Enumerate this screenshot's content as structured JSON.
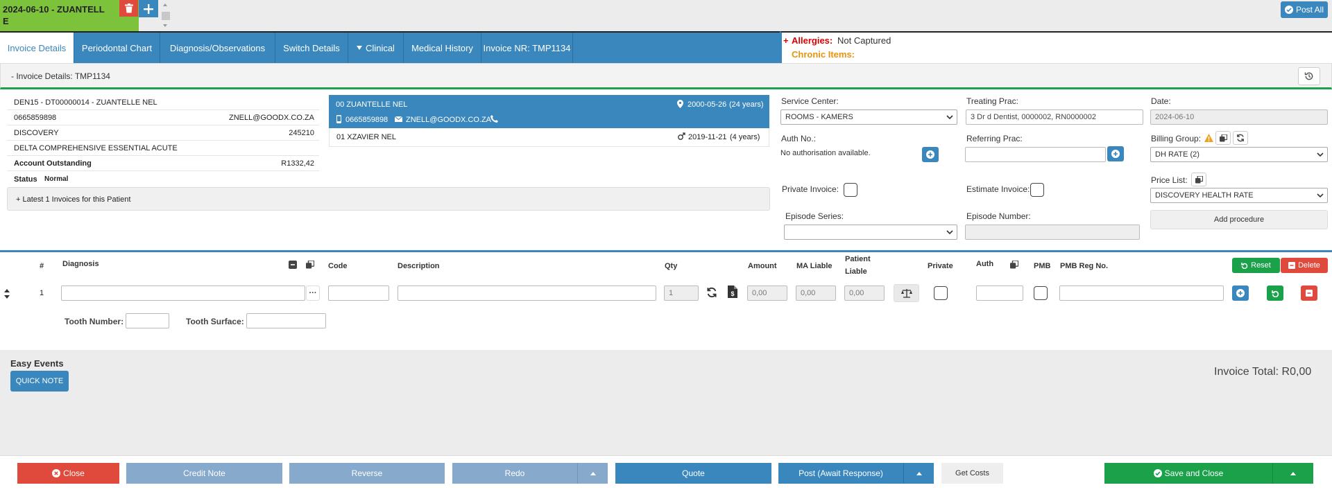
{
  "top": {
    "patient_tab_line1": "2024-06-10 - ZUANTELL",
    "patient_tab_line2": "E",
    "post_all_label": "Post All"
  },
  "tabs": {
    "invoice_details": "Invoice Details",
    "periodontal_chart": "Periodontal Chart",
    "diagnosis": "Diagnosis/Observations",
    "switch_details": "Switch Details",
    "clinical": "Clinical",
    "medical_history": "Medical History",
    "invoice_nr": "Invoice NR: TMP1134"
  },
  "alerts": {
    "plus": "+",
    "allergies_label": "Allergies:",
    "allergies_value": "Not Captured",
    "chronic_label": "Chronic Items:"
  },
  "section_header": "- Invoice Details: TMP1134",
  "patient_info": {
    "line1": "DEN15 -  DT00000014  -  ZUANTELLE NEL",
    "phone": "0665859898",
    "email": "ZNELL@GOODX.CO.ZA",
    "medical_aid": "DISCOVERY",
    "member_no": "245210",
    "plan": "DELTA COMPREHENSIVE ESSENTIAL ACUTE",
    "account_label": "Account Outstanding",
    "account_value": "R1332,42",
    "status_label": "Status",
    "status_value": "Normal",
    "latest_invoices": "+ Latest 1 Invoices for this Patient"
  },
  "dependants": [
    {
      "name": "00 ZUANTELLE NEL",
      "dob": "2000-05-26",
      "age": "(24 years)",
      "phone": "0665859898",
      "email": "ZNELL@GOODX.CO.ZA"
    },
    {
      "name": "01 XZAVIER NEL",
      "dob": "2019-11-21",
      "age": "(4 years)"
    }
  ],
  "form": {
    "service_center_label": "Service Center:",
    "service_center_value": "ROOMS - KAMERS",
    "treating_prac_label": "Treating Prac:",
    "treating_prac_value": "3 Dr d Dentist, 0000002, RN0000002",
    "date_label": "Date:",
    "date_value": "2024-06-10",
    "auth_label": "Auth No.:",
    "auth_value": "No authorisation available.",
    "referring_label": "Referring Prac:",
    "billing_label": "Billing Group:",
    "billing_value": "DH RATE (2)",
    "private_label": "Private Invoice:",
    "estimate_label": "Estimate Invoice:",
    "price_list_label": "Price List:",
    "price_list_value": "DISCOVERY HEALTH RATE",
    "episode_series_label": "Episode Series:",
    "episode_number_label": "Episode Number:",
    "add_procedure": "Add procedure"
  },
  "table": {
    "headers": {
      "num": "#",
      "diagnosis": "Diagnosis",
      "code": "Code",
      "description": "Description",
      "qty": "Qty",
      "amount": "Amount",
      "ma_liable": "MA Liable",
      "patient_liable_1": "Patient",
      "patient_liable_2": "Liable",
      "private": "Private",
      "auth": "Auth",
      "pmb": "PMB",
      "pmb_reg": "PMB Reg No."
    },
    "reset_label": "Reset",
    "delete_label": "Delete",
    "row": {
      "num": "1",
      "qty": "1",
      "amount": "0,00",
      "ma_liable": "0,00",
      "patient_liable": "0,00"
    },
    "tooth_number_label": "Tooth Number:",
    "tooth_surface_label": "Tooth  Surface:"
  },
  "easy_events": {
    "title": "Easy Events",
    "quick_note": "QUICK NOTE"
  },
  "invoice_total": "Invoice Total: R0,00",
  "footer": {
    "close": "Close",
    "credit_note": "Credit Note",
    "reverse": "Reverse",
    "redo": "Redo",
    "quote": "Quote",
    "post": "Post (Await Response)",
    "get_costs": "Get Costs",
    "save_close": "Save and Close"
  },
  "colors": {
    "primary_blue": "#3a87be",
    "light_blue": "#86a9cc",
    "green": "#1aa14a",
    "red": "#e04a3c",
    "tab_green": "#7cc33b"
  }
}
